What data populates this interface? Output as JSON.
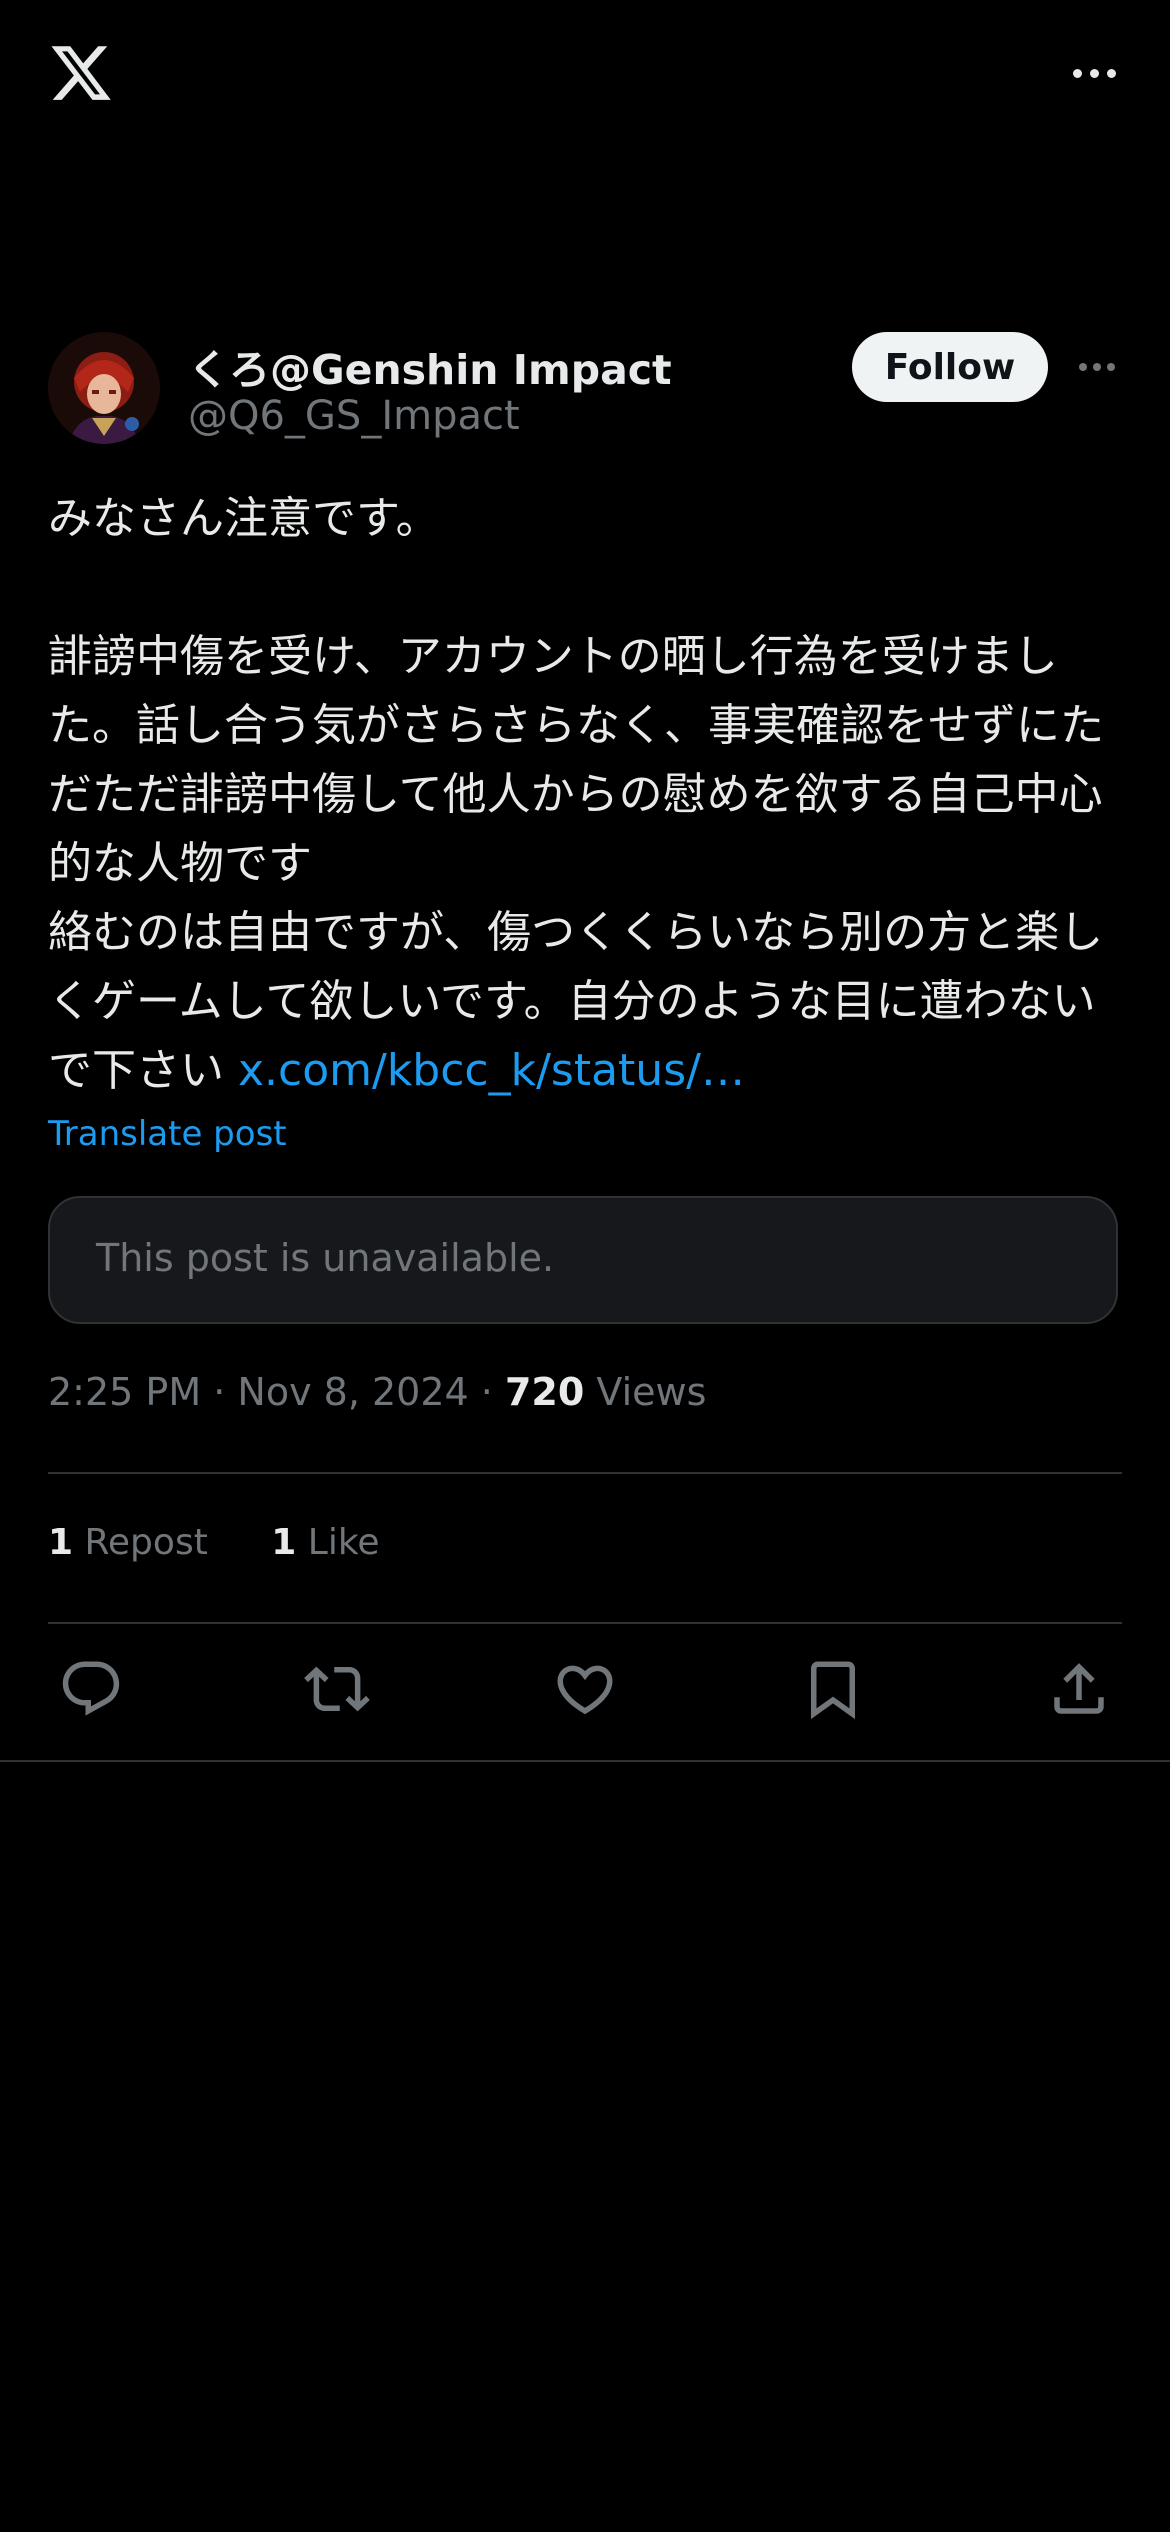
{
  "app": {
    "logo": "x-logo",
    "more_icon": "more-horizontal-icon"
  },
  "author": {
    "display_name": "くろ@Genshin Impact",
    "handle": "@Q6_GS_Impact",
    "follow_label": "Follow"
  },
  "tweet": {
    "text": "みなさん注意です。\n\n誹謗中傷を受け、アカウントの晒し行為を受けました。話し合う気がさらさらなく、事実確認をせずにただただ誹謗中傷して他人からの慰めを欲する自己中心的な人物です\n絡むのは自由ですが、傷つくくらいなら別の方と楽しくゲームして欲しいです。自分のような目に遭わないで下さい ",
    "link": "x.com/kbcc_k/status/…",
    "translate_label": "Translate post",
    "quote_unavailable": "This post is unavailable.",
    "time": "2:25 PM",
    "date": "Nov 8, 2024",
    "views_count": "720",
    "views_label": "Views",
    "sep": "·"
  },
  "stats": {
    "reposts_count": "1",
    "reposts_label": "Repost",
    "likes_count": "1",
    "likes_label": "Like"
  },
  "actions": [
    "reply-icon",
    "repost-icon",
    "like-icon",
    "bookmark-icon",
    "share-icon"
  ],
  "colors": {
    "background": "#000000",
    "text": "#e7e9ea",
    "muted": "#71767b",
    "accent": "#1d9bf0",
    "border": "#2f3336"
  }
}
